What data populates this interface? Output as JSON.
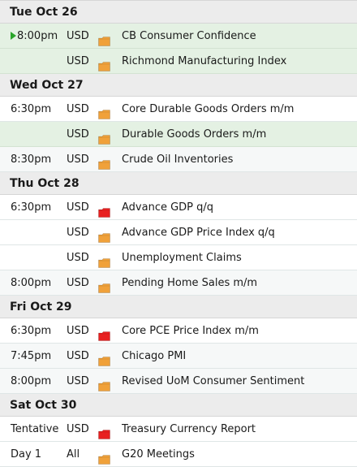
{
  "colors": {
    "medium": "#f0a13a",
    "high": "#e82020"
  },
  "days": [
    {
      "label": "Tue Oct 26",
      "rows": [
        {
          "time": "8:00pm",
          "played": true,
          "currency": "USD",
          "impact": "medium",
          "event": "CB Consumer Confidence",
          "style": "hl"
        },
        {
          "time": "",
          "currency": "USD",
          "impact": "medium",
          "event": "Richmond Manufacturing Index",
          "style": "hl"
        }
      ]
    },
    {
      "label": "Wed Oct 27",
      "rows": [
        {
          "time": "6:30pm",
          "currency": "USD",
          "impact": "medium",
          "event": "Core Durable Goods Orders m/m",
          "style": "plain"
        },
        {
          "time": "",
          "currency": "USD",
          "impact": "medium",
          "event": "Durable Goods Orders m/m",
          "style": "hl"
        },
        {
          "time": "8:30pm",
          "currency": "USD",
          "impact": "medium",
          "event": "Crude Oil Inventories",
          "style": "alt"
        }
      ]
    },
    {
      "label": "Thu Oct 28",
      "rows": [
        {
          "time": "6:30pm",
          "currency": "USD",
          "impact": "high",
          "event": "Advance GDP q/q",
          "style": "plain"
        },
        {
          "time": "",
          "currency": "USD",
          "impact": "medium",
          "event": "Advance GDP Price Index q/q",
          "style": "plain"
        },
        {
          "time": "",
          "currency": "USD",
          "impact": "medium",
          "event": "Unemployment Claims",
          "style": "plain"
        },
        {
          "time": "8:00pm",
          "currency": "USD",
          "impact": "medium",
          "event": "Pending Home Sales m/m",
          "style": "alt"
        }
      ]
    },
    {
      "label": "Fri Oct 29",
      "rows": [
        {
          "time": "6:30pm",
          "currency": "USD",
          "impact": "high",
          "event": "Core PCE Price Index m/m",
          "style": "plain"
        },
        {
          "time": "7:45pm",
          "currency": "USD",
          "impact": "medium",
          "event": "Chicago PMI",
          "style": "alt"
        },
        {
          "time": "8:00pm",
          "currency": "USD",
          "impact": "medium",
          "event": "Revised UoM Consumer Sentiment",
          "style": "alt"
        }
      ]
    },
    {
      "label": "Sat Oct 30",
      "rows": [
        {
          "time": "Tentative",
          "currency": "USD",
          "impact": "high",
          "event": "Treasury Currency Report",
          "style": "plain"
        },
        {
          "time": "Day 1",
          "currency": "All",
          "impact": "medium",
          "event": "G20 Meetings",
          "style": "plain"
        }
      ]
    }
  ]
}
